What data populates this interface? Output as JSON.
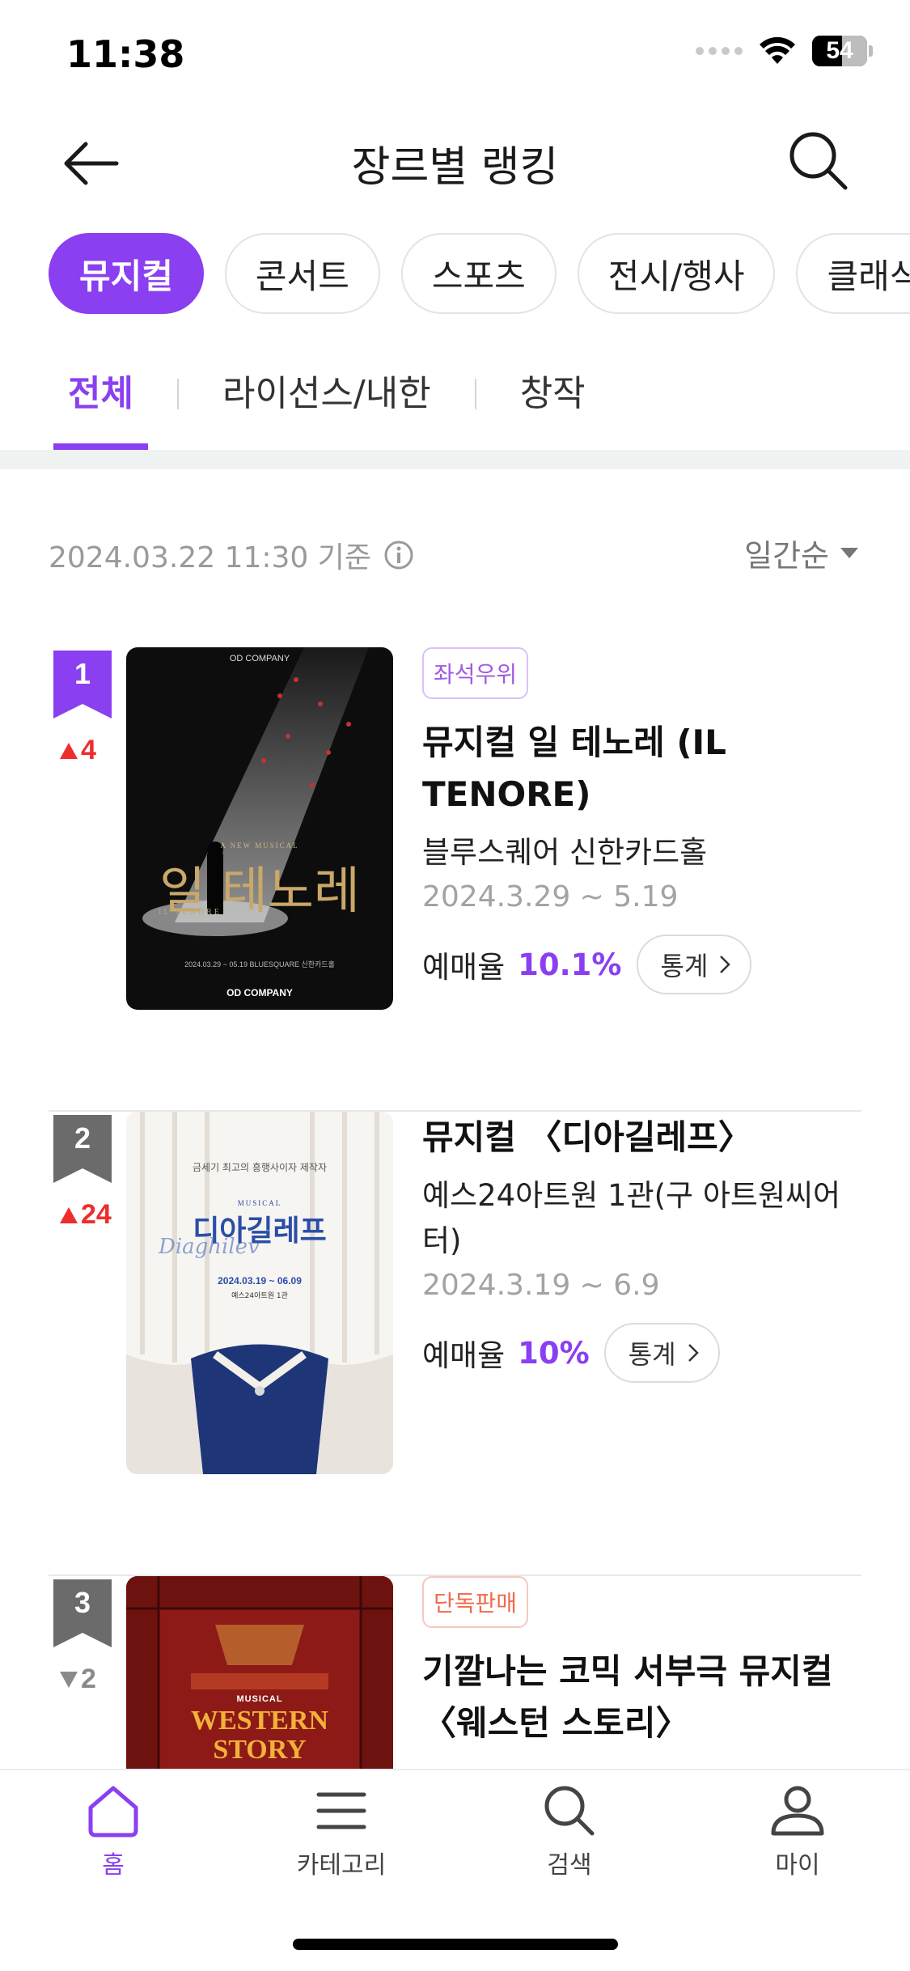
{
  "status_bar": {
    "time": "11:38",
    "battery": "54",
    "battery_level_percent": 54
  },
  "header": {
    "title": "장르별 랭킹",
    "back_icon": "arrow-left-icon",
    "search_icon": "search-icon"
  },
  "genres": [
    {
      "label": "뮤지컬",
      "active": true
    },
    {
      "label": "콘서트",
      "active": false
    },
    {
      "label": "스포츠",
      "active": false
    },
    {
      "label": "전시/행사",
      "active": false
    },
    {
      "label": "클래식",
      "active": false
    }
  ],
  "subtabs": [
    {
      "label": "전체",
      "active": true
    },
    {
      "label": "라이선스/내한",
      "active": false
    },
    {
      "label": "창작",
      "active": false
    }
  ],
  "basis": {
    "text": "2024.03.22 11:30 기준",
    "sort_label": "일간순"
  },
  "items": [
    {
      "rank": "1",
      "change": "4",
      "direction": "up",
      "badge_color": "#8a3ff0",
      "tag": "좌석우위",
      "title": "뮤지컬 일 테노레 (IL TENORE)",
      "venue": "블루스퀘어 신한카드홀",
      "dates": "2024.3.29 ~ 5.19",
      "rate_label": "예매율",
      "rate": "10.1%",
      "stat_label": "통계",
      "poster": {
        "company": "OD COMPANY",
        "kr_title": "일 테노레",
        "en_title": "IL TENORE",
        "subtitle": "A NEW MUSICAL",
        "date_line": "2024.03.29 ~ 05.19 BLUESQUARE 신한카드홀",
        "footer": "OD COMPANY"
      }
    },
    {
      "rank": "2",
      "change": "24",
      "direction": "up",
      "badge_color": "#6b6b6b",
      "tag": "",
      "title": "뮤지컬 〈디아길레프〉",
      "venue": "예스24아트원 1관(구 아트원씨어터)",
      "dates": "2024.3.19 ~ 6.9",
      "rate_label": "예매율",
      "rate": "10%",
      "stat_label": "통계",
      "poster": {
        "top_line": "금세기 최고의 흥행사이자 제작자",
        "small": "MUSICAL",
        "kr_title": "디아길레프",
        "script": "Diaghilev",
        "date_line": "2024.03.19 ~ 06.09",
        "venue_line": "예스24아트원 1관"
      }
    },
    {
      "rank": "3",
      "change": "2",
      "direction": "down",
      "badge_color": "#6b6b6b",
      "tag": "단독판매",
      "title": "기깔나는 코믹 서부극 뮤지컬 〈웨스턴 스토리〉",
      "venue": "",
      "dates": "",
      "rate_label": "",
      "rate": "",
      "stat_label": "",
      "poster": {
        "small": "MUSICAL",
        "line1": "WESTERN",
        "line2": "STORY"
      }
    }
  ],
  "bottom_nav": [
    {
      "label": "홈",
      "icon": "home-icon",
      "active": true
    },
    {
      "label": "카테고리",
      "icon": "menu-icon",
      "active": false
    },
    {
      "label": "검색",
      "icon": "search-icon",
      "active": false
    },
    {
      "label": "마이",
      "icon": "user-icon",
      "active": false
    }
  ]
}
